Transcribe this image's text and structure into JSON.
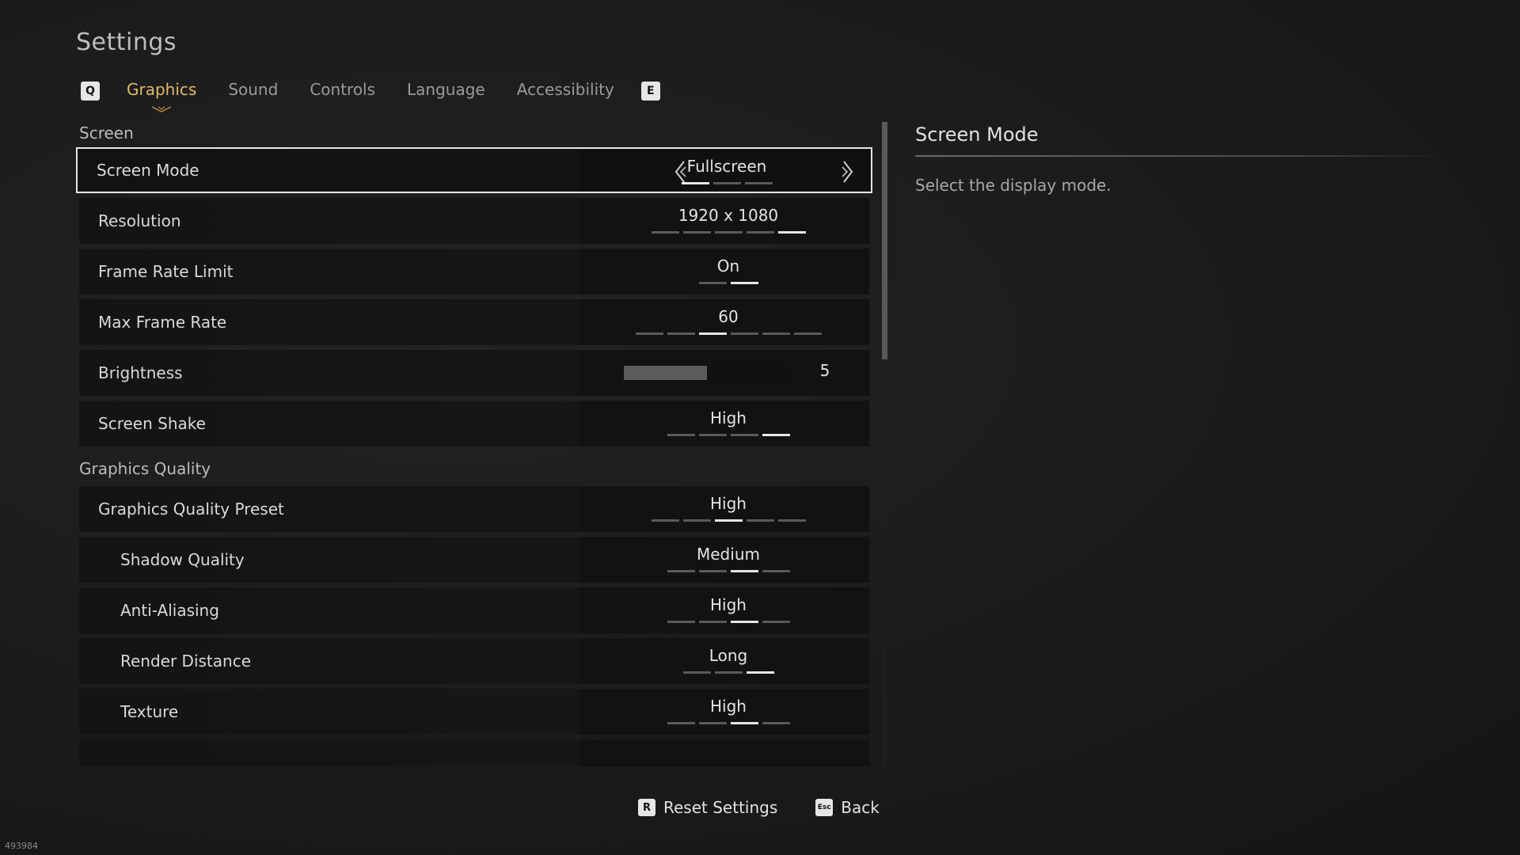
{
  "page": {
    "title": "Settings",
    "build": "493984"
  },
  "tabs": {
    "prev_key": "Q",
    "next_key": "E",
    "items": [
      {
        "label": "Graphics",
        "active": true
      },
      {
        "label": "Sound"
      },
      {
        "label": "Controls"
      },
      {
        "label": "Language"
      },
      {
        "label": "Accessibility"
      }
    ]
  },
  "sections": {
    "screen": {
      "heading": "Screen",
      "rows": {
        "screen_mode": {
          "label": "Screen Mode",
          "value": "Fullscreen",
          "options_count": 3,
          "selected_index": 0
        },
        "resolution": {
          "label": "Resolution",
          "value": "1920 x 1080",
          "options_count": 5,
          "selected_index": 4
        },
        "frame_rate_limit": {
          "label": "Frame Rate Limit",
          "value": "On",
          "options_count": 2,
          "selected_index": 1
        },
        "max_frame_rate": {
          "label": "Max Frame Rate",
          "value": "60",
          "options_count": 6,
          "selected_index": 2
        },
        "brightness": {
          "label": "Brightness",
          "value": "5",
          "level_fraction": 0.5
        },
        "screen_shake": {
          "label": "Screen Shake",
          "value": "High",
          "options_count": 4,
          "selected_index": 3
        }
      }
    },
    "graphics_quality": {
      "heading": "Graphics Quality",
      "rows": {
        "preset": {
          "label": "Graphics Quality Preset",
          "value": "High",
          "options_count": 5,
          "selected_index": 2
        },
        "shadow": {
          "label": "Shadow Quality",
          "value": "Medium",
          "options_count": 4,
          "selected_index": 2
        },
        "anti_aliasing": {
          "label": "Anti-Aliasing",
          "value": "High",
          "options_count": 4,
          "selected_index": 2
        },
        "render_distance": {
          "label": "Render Distance",
          "value": "Long",
          "options_count": 3,
          "selected_index": 2
        },
        "texture": {
          "label": "Texture",
          "value": "High",
          "options_count": 4,
          "selected_index": 2
        }
      }
    }
  },
  "detail": {
    "title": "Screen Mode",
    "description": "Select the display mode."
  },
  "footer": {
    "reset_key": "R",
    "reset_label": "Reset Settings",
    "back_key": "Esc",
    "back_label": "Back"
  }
}
